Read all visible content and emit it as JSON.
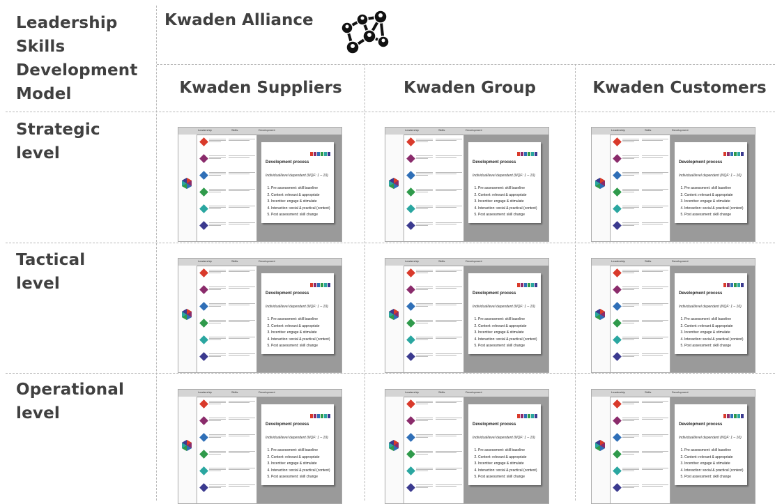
{
  "header": {
    "model_title": "Leadership Skills Development Model",
    "model_title_lines": [
      "Leadership",
      "Skills",
      "Development",
      "Model"
    ],
    "alliance": "Kwaden Alliance",
    "alliance_icon": "network-people-icon"
  },
  "columns": [
    {
      "label": "Kwaden Suppliers"
    },
    {
      "label": "Kwaden Group"
    },
    {
      "label": "Kwaden Customers"
    }
  ],
  "rows": [
    {
      "label_lines": [
        "Strategic",
        "level"
      ]
    },
    {
      "label_lines": [
        "Tactical",
        "level"
      ]
    },
    {
      "label_lines": [
        "Operational",
        "level"
      ]
    }
  ],
  "thumbnail": {
    "header_labels": [
      "Leadership",
      "Skills",
      "Development"
    ],
    "panel_title": "Development process",
    "panel_subtitle": "Individual/level dependent (NQF: 1 – 10)",
    "steps": [
      "Pre assessment: skill baseline",
      "Content: relevant & appropriate",
      "Incentive: engage & stimulate",
      "Interaction: social & practical (context)",
      "Post assessment: skill change"
    ],
    "colors": [
      "#d93a2b",
      "#8a2b6b",
      "#2f6fb7",
      "#2f9a4b",
      "#2aa6a0",
      "#3b3a8f"
    ]
  }
}
